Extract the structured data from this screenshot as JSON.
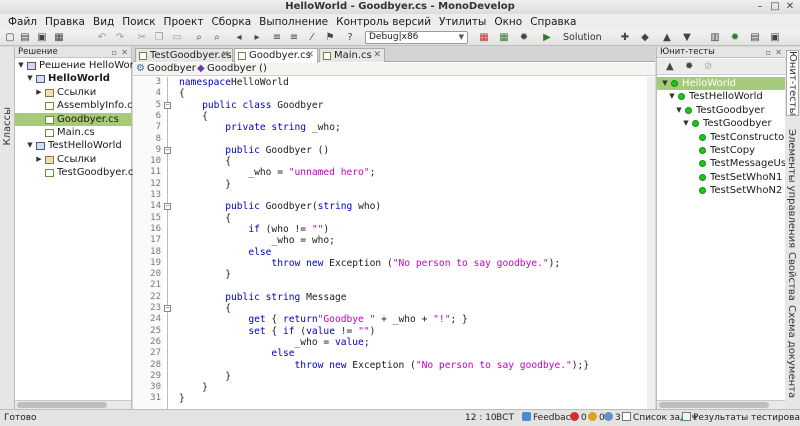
{
  "window": {
    "title": "HelloWorld - Goodbyer.cs - MonoDevelop"
  },
  "menu": [
    "Файл",
    "Правка",
    "Вид",
    "Поиск",
    "Проект",
    "Сборка",
    "Выполнение",
    "Контроль версий",
    "Утилиты",
    "Окно",
    "Справка"
  ],
  "toolbar": {
    "config": "Debug|x86",
    "solution_label": "Solution"
  },
  "left_strip": {
    "classes_tab": "Классы"
  },
  "solution_pad": {
    "title": "Решение",
    "tree": [
      {
        "label": "Решение HelloWorld",
        "level": 0,
        "icon": "solution-icon",
        "expanded": true
      },
      {
        "label": "HelloWorld",
        "level": 1,
        "icon": "project-icon",
        "bold": true,
        "expanded": true
      },
      {
        "label": "Ссылки",
        "level": 2,
        "icon": "references-icon",
        "expanded": false
      },
      {
        "label": "AssemblyInfo.cs",
        "level": 2,
        "icon": "csharp-file-icon"
      },
      {
        "label": "Goodbyer.cs",
        "level": 2,
        "icon": "csharp-file-icon",
        "selected": true
      },
      {
        "label": "Main.cs",
        "level": 2,
        "icon": "csharp-file-icon"
      },
      {
        "label": "TestHelloWorld",
        "level": 1,
        "icon": "project-icon",
        "expanded": true
      },
      {
        "label": "Ссылки",
        "level": 2,
        "icon": "references-icon",
        "expanded": false
      },
      {
        "label": "TestGoodbyer.cs",
        "level": 2,
        "icon": "csharp-file-icon"
      }
    ]
  },
  "editor": {
    "tabs": [
      {
        "label": "TestGoodbyer.cs",
        "active": false
      },
      {
        "label": "Goodbyer.cs",
        "active": true
      },
      {
        "label": "Main.cs",
        "active": false
      }
    ],
    "breadcrumb": {
      "class": "Goodbyer",
      "member": "Goodbyer ()"
    },
    "lines": [
      {
        "n": "3",
        "fold": "",
        "parts": [
          [
            "kw",
            "namespace"
          ],
          [
            "",
            "HelloWorld"
          ]
        ]
      },
      {
        "n": "4",
        "fold": "",
        "parts": [
          [
            "",
            "{"
          ]
        ]
      },
      {
        "n": "5",
        "fold": "−",
        "parts": [
          [
            "",
            "    "
          ],
          [
            "kw",
            "public class"
          ],
          [
            "",
            " Goodbyer"
          ]
        ]
      },
      {
        "n": "6",
        "fold": "",
        "parts": [
          [
            "",
            "    {"
          ]
        ]
      },
      {
        "n": "7",
        "fold": "",
        "parts": [
          [
            "",
            "        "
          ],
          [
            "kw",
            "private string"
          ],
          [
            "",
            " _who;"
          ]
        ]
      },
      {
        "n": "8",
        "fold": "",
        "parts": []
      },
      {
        "n": "9",
        "fold": "−",
        "parts": [
          [
            "",
            "        "
          ],
          [
            "kw",
            "public"
          ],
          [
            "",
            " Goodbyer ()"
          ]
        ]
      },
      {
        "n": "10",
        "fold": "",
        "parts": [
          [
            "",
            "        {"
          ]
        ]
      },
      {
        "n": "11",
        "fold": "",
        "parts": [
          [
            "",
            "            _who = "
          ],
          [
            "str",
            "\"unnamed hero\""
          ],
          [
            "",
            ";"
          ]
        ]
      },
      {
        "n": "12",
        "fold": "",
        "parts": [
          [
            "",
            "        }"
          ]
        ]
      },
      {
        "n": "13",
        "fold": "",
        "parts": []
      },
      {
        "n": "14",
        "fold": "−",
        "parts": [
          [
            "",
            "        "
          ],
          [
            "kw",
            "public"
          ],
          [
            "",
            " Goodbyer("
          ],
          [
            "kw",
            "string"
          ],
          [
            "",
            " who)"
          ]
        ]
      },
      {
        "n": "15",
        "fold": "",
        "parts": [
          [
            "",
            "        {"
          ]
        ]
      },
      {
        "n": "16",
        "fold": "",
        "parts": [
          [
            "",
            "            "
          ],
          [
            "kw",
            "if"
          ],
          [
            "",
            " (who != "
          ],
          [
            "str",
            "\"\""
          ],
          [
            "",
            ")"
          ]
        ]
      },
      {
        "n": "17",
        "fold": "",
        "parts": [
          [
            "",
            "                _who = who;"
          ]
        ]
      },
      {
        "n": "18",
        "fold": "",
        "parts": [
          [
            "",
            "            "
          ],
          [
            "kw",
            "else"
          ]
        ]
      },
      {
        "n": "19",
        "fold": "",
        "parts": [
          [
            "",
            "                "
          ],
          [
            "kw",
            "throw new"
          ],
          [
            "",
            " Exception ("
          ],
          [
            "str",
            "\"No person to say goodbye.\""
          ],
          [
            "",
            ");"
          ]
        ]
      },
      {
        "n": "20",
        "fold": "",
        "parts": [
          [
            "",
            "        }"
          ]
        ]
      },
      {
        "n": "21",
        "fold": "",
        "parts": []
      },
      {
        "n": "22",
        "fold": "",
        "parts": [
          [
            "",
            "        "
          ],
          [
            "kw",
            "public string"
          ],
          [
            "",
            " Message"
          ]
        ]
      },
      {
        "n": "23",
        "fold": "−",
        "parts": [
          [
            "",
            "        {"
          ]
        ]
      },
      {
        "n": "24",
        "fold": "",
        "parts": [
          [
            "",
            "            "
          ],
          [
            "kw",
            "get"
          ],
          [
            "",
            " { "
          ],
          [
            "kw",
            "return"
          ],
          [
            " ",
            ""
          ],
          [
            "str",
            "\"Goodbye \""
          ],
          [
            "",
            " + _who + "
          ],
          [
            "str",
            "\"!\""
          ],
          [
            "",
            "; }"
          ]
        ]
      },
      {
        "n": "25",
        "fold": "",
        "parts": [
          [
            "",
            "            "
          ],
          [
            "kw",
            "set"
          ],
          [
            "",
            " { "
          ],
          [
            "kw",
            "if"
          ],
          [
            "",
            " ("
          ],
          [
            "kw",
            "value"
          ],
          [
            "",
            " != "
          ],
          [
            "str",
            "\"\""
          ],
          [
            "",
            ")"
          ]
        ]
      },
      {
        "n": "26",
        "fold": "",
        "parts": [
          [
            "",
            "                    _who = "
          ],
          [
            "kw",
            "value"
          ],
          [
            "",
            ";"
          ]
        ]
      },
      {
        "n": "27",
        "fold": "",
        "parts": [
          [
            "",
            "                "
          ],
          [
            "kw",
            "else"
          ]
        ]
      },
      {
        "n": "28",
        "fold": "",
        "parts": [
          [
            "",
            "                    "
          ],
          [
            "kw",
            "throw new"
          ],
          [
            "",
            " Exception ("
          ],
          [
            "str",
            "\"No person to say goodbye.\""
          ],
          [
            "",
            ");}"
          ]
        ]
      },
      {
        "n": "29",
        "fold": "",
        "parts": [
          [
            "",
            "        }"
          ]
        ]
      },
      {
        "n": "30",
        "fold": "",
        "parts": [
          [
            "",
            "    }"
          ]
        ]
      },
      {
        "n": "31",
        "fold": "",
        "parts": [
          [
            "",
            "}"
          ]
        ]
      }
    ]
  },
  "unit_tests": {
    "title": "Юнит-тесты",
    "tree": [
      {
        "label": "HelloWorld",
        "level": 0,
        "selected": true
      },
      {
        "label": "TestHelloWorld",
        "level": 1
      },
      {
        "label": "TestGoodbyer",
        "level": 2
      },
      {
        "label": "TestGoodbyer",
        "level": 3
      },
      {
        "label": "TestConstructorWi",
        "level": 4
      },
      {
        "label": "TestCopy",
        "level": 4
      },
      {
        "label": "TestMessageUseC",
        "level": 4
      },
      {
        "label": "TestSetWhoN1",
        "level": 4
      },
      {
        "label": "TestSetWhoN2",
        "level": 4
      }
    ]
  },
  "right_strip": [
    "Юнит-тесты",
    "Элементы управления",
    "Свойства",
    "Схема документа"
  ],
  "status": {
    "ready": "Готово",
    "position": "12 : 10",
    "mode": "ВСТ",
    "feedback": "Feedback",
    "errors": "0",
    "warnings": "0",
    "messages": "3",
    "tasks": "Список задач",
    "test_results": "Результаты тестирования"
  },
  "colors": {
    "selection": "#a6c97a",
    "keyword": "#0000c8",
    "string": "#c800c8",
    "test_pass": "#1cc41c"
  }
}
